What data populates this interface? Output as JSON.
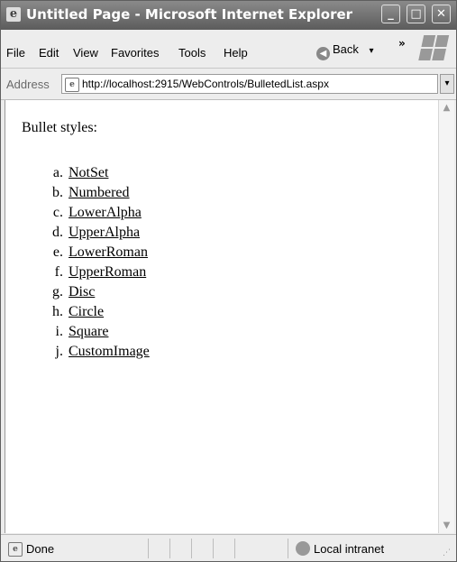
{
  "window": {
    "title": "Untitled Page - Microsoft Internet Explorer",
    "minimize_glyph": "_",
    "maximize_glyph": "□",
    "close_glyph": "✕"
  },
  "menubar": {
    "items": [
      {
        "label": "File"
      },
      {
        "label": "Edit"
      },
      {
        "label": "View"
      },
      {
        "label": "Favorites"
      },
      {
        "label": "Tools"
      },
      {
        "label": "Help"
      }
    ],
    "back_label": "Back",
    "back_dropdown": "▾",
    "chevron": "»"
  },
  "addressbar": {
    "label": "Address",
    "url": "http://localhost:2915/WebControls/BulletedList.aspx",
    "dropdown_glyph": "▾"
  },
  "page": {
    "heading": "Bullet styles:",
    "items": [
      {
        "marker": "a.",
        "label": "NotSet"
      },
      {
        "marker": "b.",
        "label": "Numbered"
      },
      {
        "marker": "c.",
        "label": "LowerAlpha"
      },
      {
        "marker": "d.",
        "label": "UpperAlpha"
      },
      {
        "marker": "e.",
        "label": "LowerRoman"
      },
      {
        "marker": "f.",
        "label": "UpperRoman"
      },
      {
        "marker": "g.",
        "label": "Disc"
      },
      {
        "marker": "h.",
        "label": "Circle"
      },
      {
        "marker": "i.",
        "label": "Square"
      },
      {
        "marker": "j.",
        "label": "CustomImage"
      }
    ]
  },
  "scrollbar": {
    "up_glyph": "▲",
    "down_glyph": "▼"
  },
  "statusbar": {
    "status": "Done",
    "zone": "Local intranet"
  },
  "icons": {
    "ie_page": "ie-page-icon",
    "back": "back-arrow-icon",
    "windows_logo": "windows-logo-icon",
    "zone": "intranet-globe-icon",
    "resize_grip": "resize-grip-icon"
  }
}
